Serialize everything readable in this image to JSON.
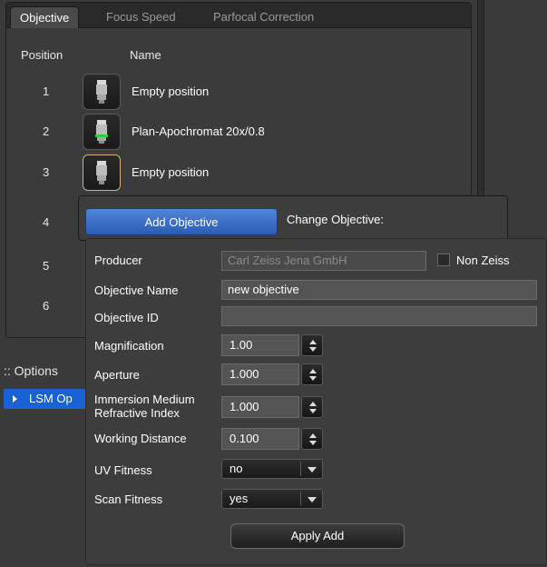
{
  "tabs": [
    "Objective",
    "Focus Speed",
    "Parfocal Correction"
  ],
  "columns": {
    "position": "Position",
    "name": "Name"
  },
  "rows": [
    {
      "position": "1",
      "name": "Empty position",
      "icon": "objective-lens-icon"
    },
    {
      "position": "2",
      "name": "Plan-Apochromat 20x/0.8",
      "icon": "objective-lens-green-icon"
    },
    {
      "position": "3",
      "name": "Empty position",
      "icon": "objective-lens-icon"
    },
    {
      "position": "4",
      "name": ""
    },
    {
      "position": "5",
      "name": ""
    },
    {
      "position": "6",
      "name": ""
    }
  ],
  "options": {
    "header": ":: Options",
    "item": "LSM Op"
  },
  "popup": {
    "add_objective": "Add Objective",
    "change_objective": "Change Objective:"
  },
  "form": {
    "producer_label": "Producer",
    "producer_value": "Carl Zeiss Jena GmbH",
    "non_zeiss_label": "Non Zeiss",
    "objective_name_label": "Objective Name",
    "objective_name_value": "new objective",
    "objective_id_label": "Objective ID",
    "objective_id_value": "",
    "magnification_label": "Magnification",
    "magnification_value": "1.00",
    "aperture_label": "Aperture",
    "aperture_value": "1.000",
    "immersion_label_1": "Immersion Medium",
    "immersion_label_2": "Refractive Index",
    "immersion_value": "1.000",
    "working_distance_label": "Working Distance",
    "working_distance_value": "0.100",
    "uv_fitness_label": "UV Fitness",
    "uv_fitness_value": "no",
    "scan_fitness_label": "Scan Fitness",
    "scan_fitness_value": "yes",
    "apply_label": "Apply Add"
  },
  "colors": {
    "accent": "#1862d6",
    "selected_border": "#d2b07a",
    "lens_green": "#2ecc40"
  }
}
